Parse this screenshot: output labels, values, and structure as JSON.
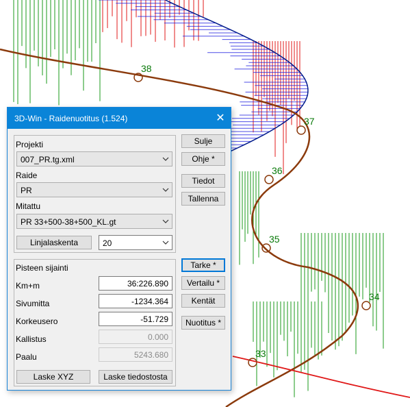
{
  "plot": {
    "station_labels": [
      "38",
      "37",
      "36",
      "35",
      "34",
      "33"
    ],
    "colors": {
      "curve": "#8b3a0c",
      "green": "#1a9a1a",
      "red": "#e01818",
      "blue": "#2020e0",
      "navy": "#001a8a",
      "label": "#0a7a0a"
    }
  },
  "dialog": {
    "title": "3D-Win - Raidenuotitus  (1.524)",
    "close_glyph": "✕",
    "projekti_label": "Projekti",
    "projekti_value": "007_PR.tg.xml",
    "raide_label": "Raide",
    "raide_value": "PR",
    "mitattu_label": "Mitattu",
    "mitattu_value": "PR 33+500-38+500_KL.gt",
    "linjalaskenta_label": "Linjalaskenta",
    "linjalaskenta_value": "20",
    "position_group_title": "Pisteen sijainti",
    "kmm_label": "Km+m",
    "kmm_value": "36:226.890",
    "sivumitta_label": "Sivumitta",
    "sivumitta_value": "-1234.364",
    "korkeusero_label": "Korkeusero",
    "korkeusero_value": "-51.729",
    "kallistus_label": "Kallistus",
    "kallistus_value": "0.000",
    "paalu_label": "Paalu",
    "paalu_value": "5243.680",
    "laske_xyz_label": "Laske XYZ",
    "laske_tiedostosta_label": "Laske tiedostosta",
    "buttons": {
      "sulje": "Sulje",
      "ohje": "Ohje *",
      "tiedot": "Tiedot",
      "tallenna": "Tallenna",
      "tarke": "Tarke *",
      "vertailu": "Vertailu *",
      "kentat": "Kentät",
      "nuotitus": "Nuotitus *"
    }
  }
}
